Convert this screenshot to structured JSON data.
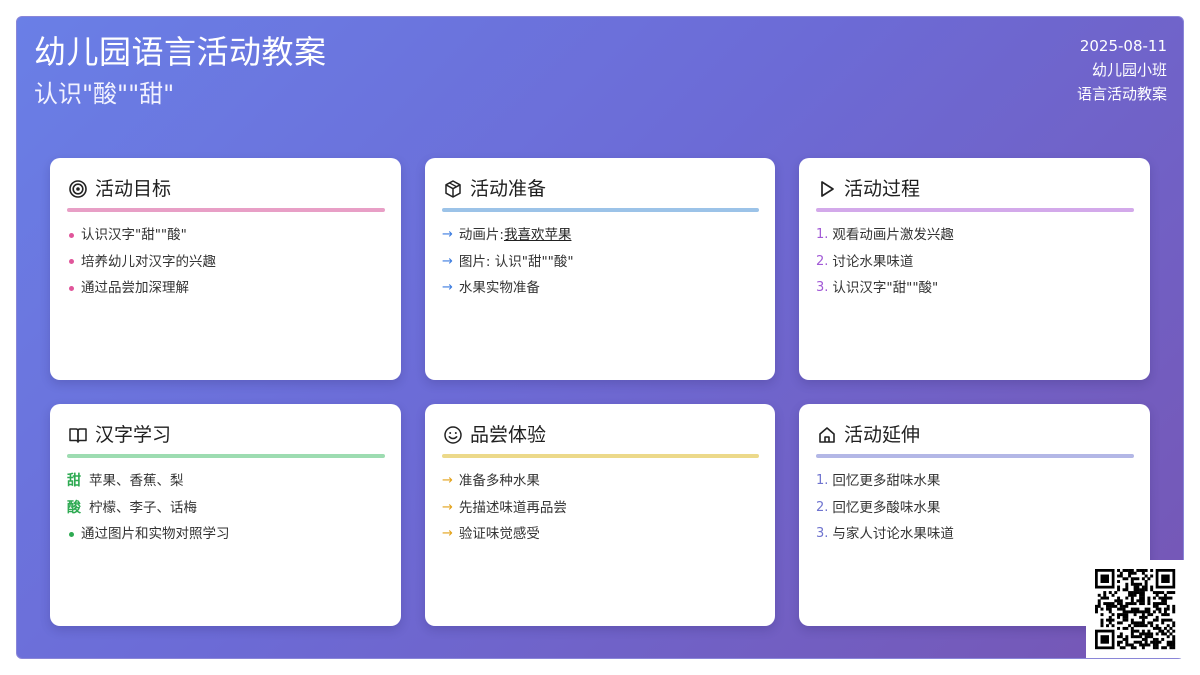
{
  "header": {
    "title": "幼儿园语言活动教案",
    "subtitle": "认识\"酸\"\"甜\"",
    "date": "2025-08-11",
    "class_name": "幼儿园小班",
    "doc_type": "语言活动教案"
  },
  "cards": [
    {
      "title": "活动目标",
      "icon": "target-icon",
      "accent": "#e89fc6",
      "items": [
        "认识汉字\"甜\"\"酸\"",
        "培养幼儿对汉字的兴趣",
        "通过品尝加深理解"
      ]
    },
    {
      "title": "活动准备",
      "icon": "box-icon",
      "accent": "#9cc3e8",
      "items": [
        {
          "prefix": "动画片: ",
          "link": "我喜欢苹果"
        },
        {
          "prefix": "图片: 认识\"甜\"\"酸\""
        },
        {
          "prefix": "水果实物准备"
        }
      ]
    },
    {
      "title": "活动过程",
      "icon": "play-icon",
      "accent": "#d3a9ea",
      "items": [
        "1.",
        "观看动画片激发兴趣",
        "2.",
        "讨论水果味道",
        "3.",
        "认识汉字\"甜\"\"酸\""
      ]
    },
    {
      "title": "汉字学习",
      "icon": "book-icon",
      "accent": "#9ddcb1",
      "items": [
        {
          "char": "甜",
          "text": "苹果、香蕉、梨"
        },
        {
          "char": "酸",
          "text": "柠檬、李子、话梅"
        },
        {
          "text": "通过图片和实物对照学习"
        }
      ]
    },
    {
      "title": "品尝体验",
      "icon": "smile-icon",
      "accent": "#ecd98a",
      "items": [
        "准备多种水果",
        "先描述味道再品尝",
        "验证味觉感受"
      ]
    },
    {
      "title": "活动延伸",
      "icon": "home-icon",
      "accent": "#b3b7e6",
      "items": [
        "1.",
        "回忆更多甜味水果",
        "2.",
        "回忆更多酸味水果",
        "3.",
        "与家人讨论水果味道"
      ]
    }
  ],
  "colors": {
    "pink_marker": "#e0559a",
    "blue_arrow": "#3d7de0",
    "purple_number": "#a25ad6",
    "green_marker": "#2eaa52",
    "orange_arrow": "#e3a21a",
    "indigo_number": "#6f74cf"
  }
}
